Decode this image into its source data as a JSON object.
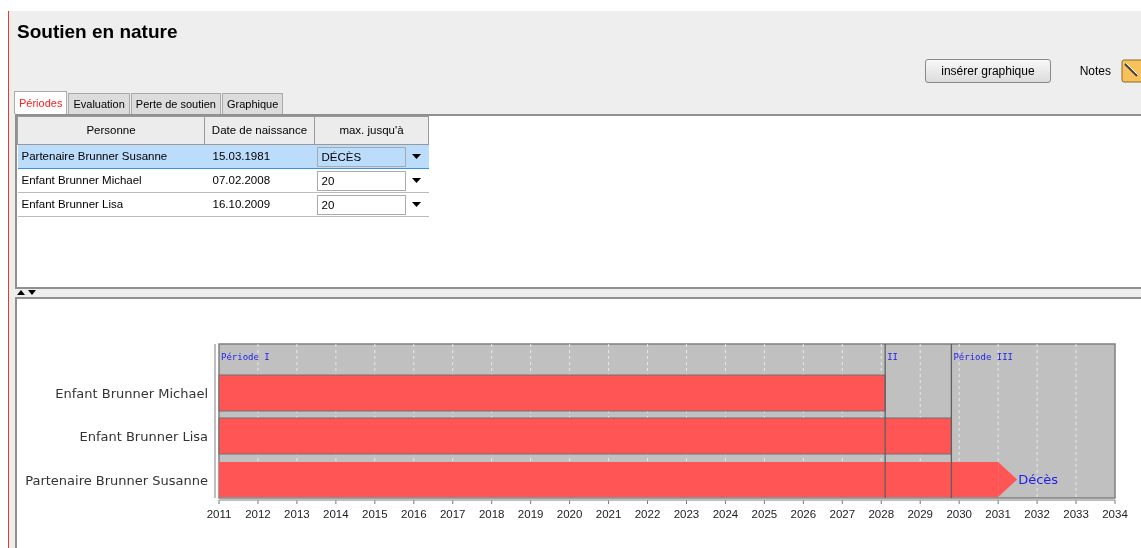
{
  "title": "Soutien en nature",
  "toolbar": {
    "insert_button": "insérer graphique",
    "notes_label": "Notes"
  },
  "tabs": [
    {
      "label": "Périodes",
      "selected": true
    },
    {
      "label": "Evaluation",
      "selected": false
    },
    {
      "label": "Perte de soutien",
      "selected": false
    },
    {
      "label": "Graphique",
      "selected": false
    }
  ],
  "table": {
    "columns": [
      "Personne",
      "Date de naissance",
      "max. jusqu'à"
    ],
    "rows": [
      {
        "person": "Partenaire Brunner Susanne",
        "birth_date": "15.03.1981",
        "max_until": "DÉCÈS",
        "selected": true
      },
      {
        "person": "Enfant Brunner Michael",
        "birth_date": "07.02.2008",
        "max_until": "20",
        "selected": false
      },
      {
        "person": "Enfant Brunner Lisa",
        "birth_date": "16.10.2009",
        "max_until": "20",
        "selected": false
      }
    ]
  },
  "chart": {
    "chart_data": {
      "type": "bar",
      "orientation": "horizontal",
      "categories": [
        "Enfant Brunner Michael",
        "Enfant Brunner Lisa",
        "Partenaire Brunner Susanne"
      ],
      "values": [
        2028.1,
        2029.8,
        2031
      ],
      "grid": true,
      "xlim": [
        2011,
        2034
      ],
      "xticks": [
        2011,
        2012,
        2013,
        2014,
        2015,
        2016,
        2017,
        2018,
        2019,
        2020,
        2021,
        2022,
        2023,
        2024,
        2025,
        2026,
        2027,
        2028,
        2029,
        2030,
        2031,
        2032,
        2033,
        2034
      ],
      "ref_lines": [
        {
          "axis": "x",
          "value": 2028.1,
          "label": "II"
        },
        {
          "axis": "x",
          "value": 2029.8,
          "label": "Période III"
        }
      ],
      "annotations": [
        "Période I",
        "Décès"
      ]
    }
  }
}
